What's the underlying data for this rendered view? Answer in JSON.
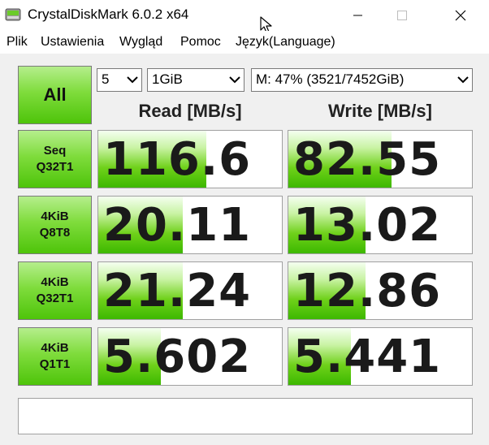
{
  "window": {
    "title": "CrystalDiskMark 6.0.2 x64",
    "icon": "disk-icon"
  },
  "menu": [
    "Plik",
    "Ustawienia",
    "Wygląd",
    "Pomoc",
    "Język(Language)"
  ],
  "controls": {
    "all_label": "All",
    "count": "5",
    "size": "1GiB",
    "drive": "M: 47% (3521/7452GiB)"
  },
  "headers": {
    "read": "Read [MB/s]",
    "write": "Write [MB/s]"
  },
  "tests": [
    {
      "line1": "Seq",
      "line2": "Q32T1",
      "read": "116.6",
      "write": "82.55",
      "read_fill": 0.59,
      "write_fill": 0.56
    },
    {
      "line1": "4KiB",
      "line2": "Q8T8",
      "read": "20.11",
      "write": "13.02",
      "read_fill": 0.46,
      "write_fill": 0.42
    },
    {
      "line1": "4KiB",
      "line2": "Q32T1",
      "read": "21.24",
      "write": "12.86",
      "read_fill": 0.46,
      "write_fill": 0.42
    },
    {
      "line1": "4KiB",
      "line2": "Q1T1",
      "read": "5.602",
      "write": "5.441",
      "read_fill": 0.34,
      "write_fill": 0.34
    }
  ],
  "status": "",
  "colors": {
    "accent_green": "#4ec40a",
    "bar_green": "#3db800"
  }
}
